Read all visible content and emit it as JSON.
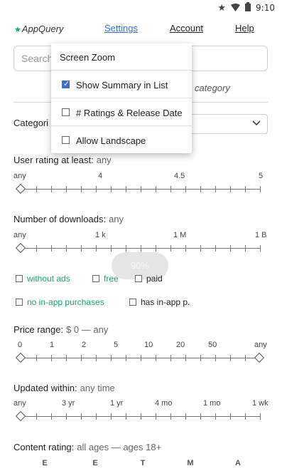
{
  "status_bar": {
    "time": "9:10",
    "icons": [
      "star-icon",
      "wifi-icon",
      "battery-icon"
    ]
  },
  "nav": {
    "brand": "AppQuery",
    "links": [
      "Settings",
      "Account",
      "Help"
    ]
  },
  "search": {
    "placeholder": "Search"
  },
  "category_hint": "category",
  "category": {
    "label": "Categori",
    "selected": ""
  },
  "settings_menu": {
    "items": [
      {
        "label": "Screen Zoom",
        "has_checkbox": false,
        "checked": false
      },
      {
        "label": "Show Summary in List",
        "has_checkbox": true,
        "checked": true
      },
      {
        "label": "# Ratings & Release Date",
        "has_checkbox": true,
        "checked": false
      },
      {
        "label": "Allow Landscape",
        "has_checkbox": true,
        "checked": false
      }
    ]
  },
  "user_rating": {
    "title": "User rating at least:",
    "value": "any",
    "scale": [
      "any",
      "4",
      "4.5",
      "5"
    ],
    "selected_index": 0
  },
  "downloads": {
    "title": "Number of downloads:",
    "value": "any",
    "scale": [
      "any",
      "1 k",
      "1 M",
      "1 B"
    ],
    "selected_index": 0
  },
  "ad_filters": [
    {
      "label": "without ads",
      "checked": false,
      "highlight": true
    },
    {
      "label": "free",
      "checked": false,
      "highlight": true
    },
    {
      "label": "paid",
      "checked": false,
      "highlight": false
    }
  ],
  "iap_filters": [
    {
      "label": "no in-app purchases",
      "checked": false,
      "highlight": true
    },
    {
      "label": "has in-app p.",
      "checked": false,
      "highlight": false
    }
  ],
  "zoom_toast": "90%",
  "price": {
    "title": "Price range:",
    "value": "$ 0  —  any",
    "scale": [
      "0",
      "1",
      "2",
      "5",
      "10",
      "20",
      "50",
      "any"
    ]
  },
  "updated": {
    "title": "Updated within:",
    "value": "any time",
    "scale": [
      "any",
      "3 yr",
      "1 yr",
      "4 mo",
      "1 mo",
      "1 wk"
    ]
  },
  "content_rating": {
    "title": "Content rating:",
    "value": "all ages  —  ages 18+",
    "scale": [
      "E",
      "E",
      "T",
      "M",
      "A"
    ]
  },
  "colors": {
    "accent": "#3a6fd0",
    "green": "#1aa36b"
  }
}
